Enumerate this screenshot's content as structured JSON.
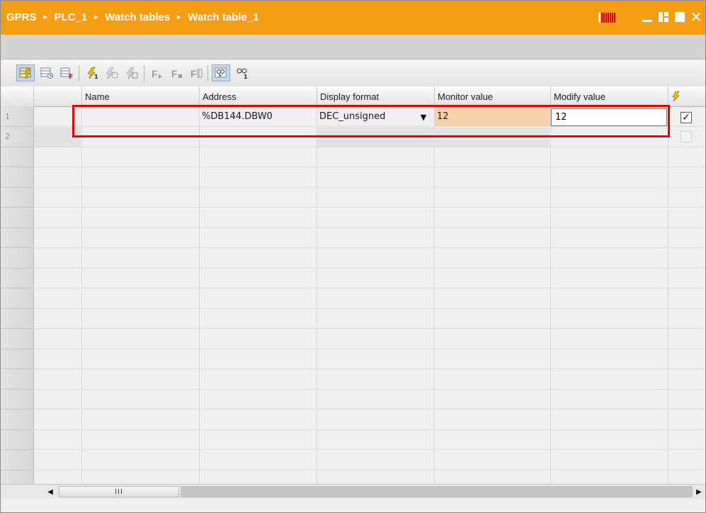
{
  "breadcrumb": [
    "GPRS",
    "PLC_1",
    "Watch tables",
    "Watch table_1"
  ],
  "breadcrumb_separator": "▸",
  "window_controls": {
    "minimize": "minimize",
    "float": "float",
    "maximize": "maximize",
    "close": "✕"
  },
  "colors": {
    "titlebar": "#f59e12",
    "monitor_highlight": "#f6d2ac",
    "selection_box": "#e60000",
    "input_border": "#4a7fd0"
  },
  "toolbar": {
    "icons": [
      "insert-row-icon",
      "add-row-icon",
      "insert-comment-row-icon",
      "modify-now-icon",
      "modify-with-trigger-icon",
      "enable-peripheral-outputs-icon",
      "force-icon",
      "force-all-icon",
      "stop-force-icon",
      "monitor-all-icon",
      "monitor-now-icon"
    ]
  },
  "table": {
    "columns": {
      "name": "Name",
      "address": "Address",
      "display_format": "Display format",
      "monitor_value": "Monitor value",
      "modify_value": "Modify value",
      "modify_flag_icon": "lightning-icon"
    },
    "rows": [
      {
        "num": "1",
        "name": "",
        "address": "%DB144.DBW0",
        "display_format": "DEC_unsigned",
        "monitor_value": "12",
        "modify_value": "12",
        "checked": true
      },
      {
        "num": "2",
        "name": "",
        "address": "",
        "display_format": "",
        "monitor_value": "",
        "modify_value": "",
        "checked": false
      }
    ]
  },
  "scrollbar": {
    "thumb_label": "III",
    "left_arrow": "◀",
    "right_arrow": "▶"
  }
}
